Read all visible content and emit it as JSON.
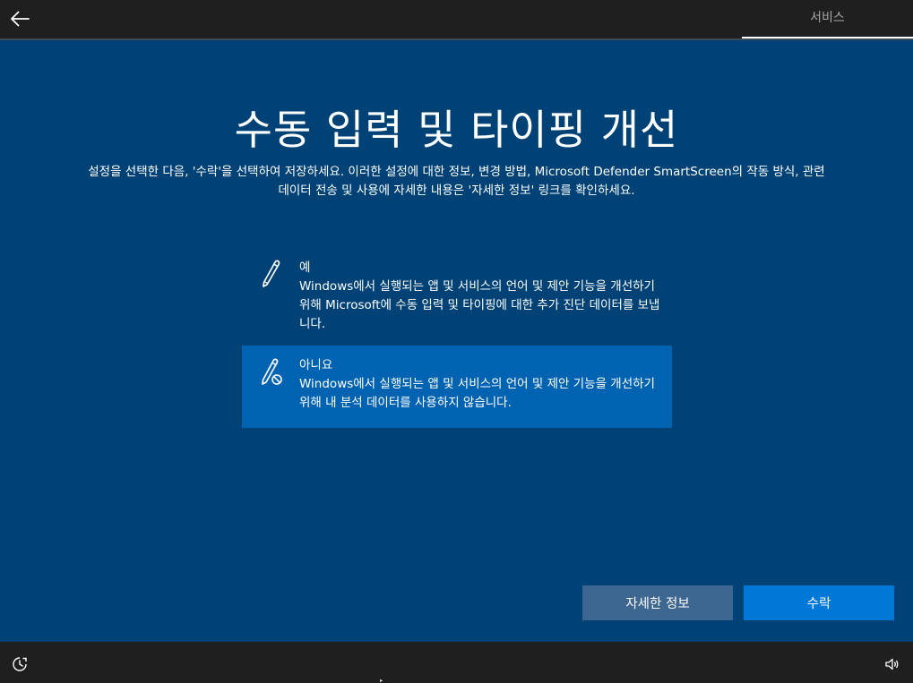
{
  "header": {
    "back_icon": "arrow-left-icon",
    "tab_label": "서비스"
  },
  "main": {
    "title": "수동 입력 및 타이핑 개선",
    "subtitle_line1": "설정을 선택한 다음, '수락'을 선택하여 저장하세요. 이러한 설정에 대한 정보, 변경 방법, Microsoft Defender SmartScreen의 작동 방식, 관련",
    "subtitle_line2": "데이터 전송 및 사용에 자세한 내용은 '자세한 정보' 링크를 확인하세요.",
    "options": [
      {
        "icon": "pen-icon",
        "label": "예",
        "description": "Windows에서 실행되는 앱 및 서비스의 언어 및 제안 기능을 개선하기 위해 Microsoft에 수동 입력 및 타이핑에 대한 추가 진단 데이터를 보냅니다.",
        "selected": false
      },
      {
        "icon": "pen-disabled-icon",
        "label": "아니요",
        "description": "Windows에서 실행되는 앱 및 서비스의 언어 및 제안 기능을 개선하기 위해 내 분석 데이터를 사용하지 않습니다.",
        "selected": true
      }
    ],
    "buttons": {
      "learn_more": "자세한 정보",
      "accept": "수락"
    }
  },
  "footer": {
    "accessibility_icon": "ease-of-access-icon",
    "volume_icon": "volume-icon"
  },
  "colors": {
    "background": "#004275",
    "selected_option": "#0063b1",
    "accept_button": "#0078d7",
    "learn_more_button": "#3d6691",
    "bars": "#1f1f1f"
  }
}
